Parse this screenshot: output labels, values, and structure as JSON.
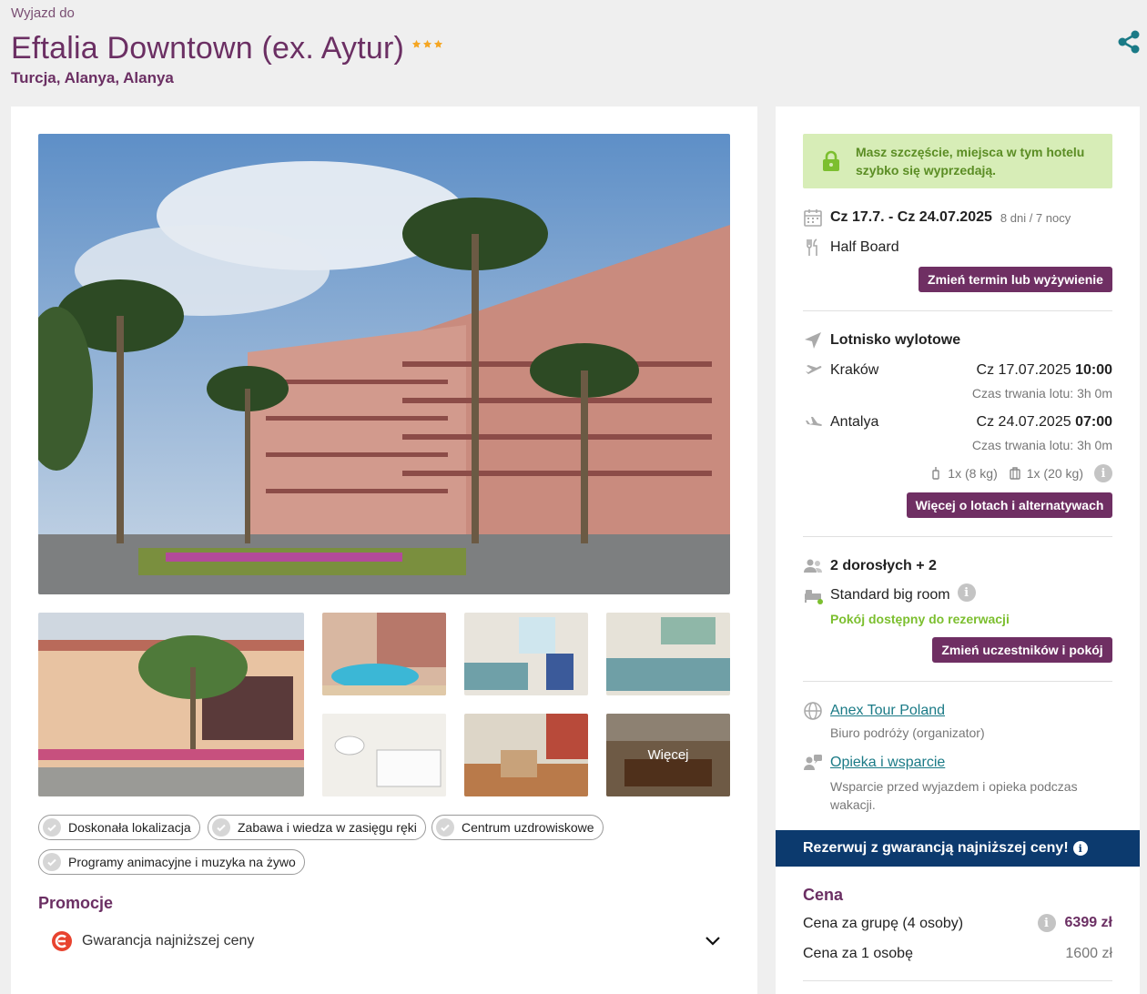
{
  "header": {
    "kicker": "Wyjazd do",
    "title": "Eftalia Downtown (ex. Aytur)",
    "stars": 3,
    "location": "Turcja, Alanya, Alanya"
  },
  "gallery": {
    "more_label": "Więcej"
  },
  "features": [
    "Doskonała lokalizacja",
    "Zabawa i wiedza w zasięgu ręki",
    "Centrum uzdrowiskowe",
    "Programy animacyjne i muzyka na żywo"
  ],
  "promotions": {
    "title": "Promocje",
    "items": [
      "Gwarancja najniższej ceny"
    ]
  },
  "booking": {
    "alert": "Masz szczęście, miejsca w tym hotelu szybko się wyprzedają.",
    "dates": "Cz 17.7. - Cz 24.07.2025",
    "duration": "8 dni / 7 nocy",
    "board": "Half Board",
    "change_date_button": "Zmień termin lub wyżywienie",
    "airport_label": "Lotnisko wylotowe",
    "outbound": {
      "city": "Kraków",
      "date": "Cz 17.07.2025",
      "time": "10:00",
      "duration": "Czas trwania lotu: 3h 0m"
    },
    "inbound": {
      "city": "Antalya",
      "date": "Cz 24.07.2025",
      "time": "07:00",
      "duration": "Czas trwania lotu: 3h 0m"
    },
    "luggage_hand": "1x (8 kg)",
    "luggage_hold": "1x (20 kg)",
    "flights_button": "Więcej o lotach i alternatywach",
    "participants": "2 dorosłych + 2",
    "room": "Standard big room",
    "room_status": "Pokój dostępny do rezerwacji",
    "participants_button": "Zmień uczestników i pokój",
    "organizer_link": "Anex Tour Poland",
    "organizer_desc": "Biuro podróży (organizator)",
    "support_link": "Opieka i wsparcie",
    "support_desc": "Wsparcie przed wyjazdem i opieka podczas wakacji."
  },
  "price": {
    "banner": "Rezerwuj z gwarancją najniższej ceny!",
    "title": "Cena",
    "group_label": "Cena za grupę (4 osoby)",
    "group_value": "6399 zł",
    "person_label": "Cena za 1 osobę",
    "person_value": "1600 zł"
  },
  "colors": {
    "brand": "#6b2f63",
    "button": "#6f2f63",
    "alert_bg": "#d7edb7",
    "alert_text": "#5b8d24",
    "banner": "#0c3a6e",
    "link": "#1a7a86",
    "star": "#f5a623"
  }
}
